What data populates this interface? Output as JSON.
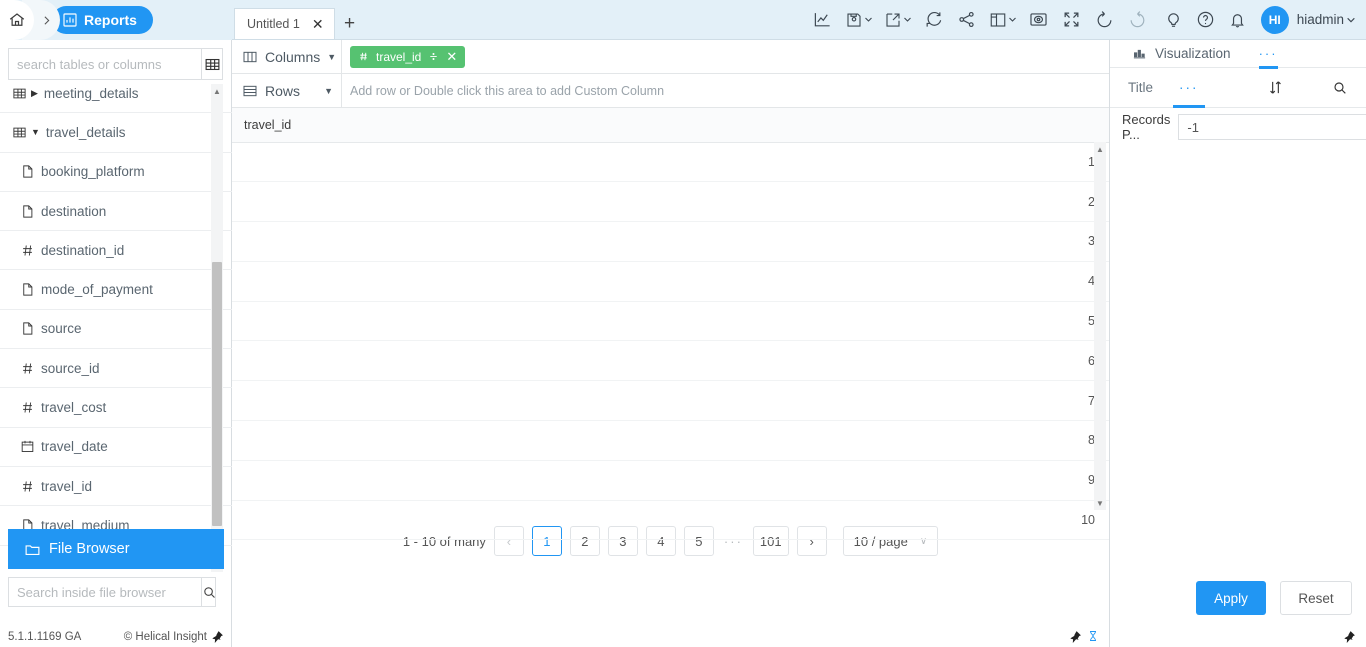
{
  "breadcrumb": {
    "home_icon": "home-icon",
    "separator": "chevron-right-icon",
    "active_label": "Reports",
    "active_icon": "bar-chart-icon"
  },
  "tabs": [
    {
      "label": "Untitled 1",
      "close": "✕",
      "active": true
    }
  ],
  "tab_add_label": "+",
  "toolbar_icons": [
    {
      "name": "line-chart-icon"
    },
    {
      "name": "save-icon",
      "caret": true
    },
    {
      "name": "export-icon",
      "caret": true
    },
    {
      "name": "refresh-icon"
    },
    {
      "name": "share-icon"
    },
    {
      "name": "layout-icon",
      "caret": true
    },
    {
      "name": "preview-icon"
    },
    {
      "name": "fullscreen-icon"
    },
    {
      "name": "undo-icon"
    },
    {
      "name": "redo-icon"
    }
  ],
  "header_right": {
    "bulb_icon": "lightbulb-icon",
    "help_icon": "help-icon",
    "bell_icon": "notification-bell-icon",
    "avatar_initials": "HI",
    "username": "hiadmin"
  },
  "sidebar": {
    "search_placeholder": "search tables or columns",
    "search_value": "",
    "grid_button_icon": "table-grid-icon",
    "tree": [
      {
        "label": "meeting_details",
        "type": "table",
        "expanded": false,
        "icon": "table-icon"
      },
      {
        "label": "travel_details",
        "type": "table",
        "expanded": true,
        "icon": "table-icon"
      },
      {
        "label": "booking_platform",
        "type": "string",
        "icon": "document-icon"
      },
      {
        "label": "destination",
        "type": "string",
        "icon": "document-icon"
      },
      {
        "label": "destination_id",
        "type": "number",
        "icon": "hash-icon"
      },
      {
        "label": "mode_of_payment",
        "type": "string",
        "icon": "document-icon"
      },
      {
        "label": "source",
        "type": "string",
        "icon": "document-icon"
      },
      {
        "label": "source_id",
        "type": "number",
        "icon": "hash-icon"
      },
      {
        "label": "travel_cost",
        "type": "number",
        "icon": "hash-icon"
      },
      {
        "label": "travel_date",
        "type": "date",
        "icon": "calendar-icon"
      },
      {
        "label": "travel_id",
        "type": "number",
        "icon": "hash-icon"
      },
      {
        "label": "travel_medium",
        "type": "string",
        "icon": "document-icon"
      }
    ],
    "file_browser": {
      "label": "File Browser",
      "icon": "folder-icon",
      "search_placeholder": "Search inside file browser",
      "search_value": "",
      "search_icon": "search-icon"
    },
    "footer": {
      "version": "5.1.1.1169 GA",
      "copyright": "© Helical Insight",
      "pin_icon": "pin-icon"
    }
  },
  "shelves": {
    "columns": {
      "label": "Columns",
      "icon": "columns-icon",
      "caret": "▼",
      "chips": [
        {
          "label": "travel_id",
          "type_icon": "hash-icon",
          "agg_icon": "divide-icon",
          "close": "✕"
        }
      ]
    },
    "rows": {
      "label": "Rows",
      "icon": "rows-icon",
      "caret": "▼",
      "placeholder": "Add row or Double click this area to add Custom Column",
      "chips": []
    }
  },
  "chart_data": {
    "type": "table",
    "title": "",
    "columns": [
      "travel_id"
    ],
    "rows": [
      [
        "1"
      ],
      [
        "2"
      ],
      [
        "3"
      ],
      [
        "4"
      ],
      [
        "5"
      ],
      [
        "6"
      ],
      [
        "7"
      ],
      [
        "8"
      ],
      [
        "9"
      ],
      [
        "10"
      ]
    ]
  },
  "pagination": {
    "summary": "1 - 10 of many",
    "prev": "‹",
    "next": "›",
    "pages": [
      "1",
      "2",
      "3",
      "4",
      "5"
    ],
    "ellipsis": "···",
    "last_page": "101",
    "active_page": "1",
    "page_size_label": "10 / page",
    "page_size_caret": "∨"
  },
  "main_footer": {
    "pin_icon": "pin-icon",
    "hourglass_icon": "hourglass-icon"
  },
  "right_panel": {
    "tabs": [
      {
        "label": "Visualization",
        "icon": "chart-panel-icon",
        "active": false
      },
      {
        "label": "···",
        "icon": "more-icon",
        "active": true
      }
    ],
    "sub_tabs": [
      {
        "label": "Title",
        "active": false
      },
      {
        "label": "···",
        "active": true
      }
    ],
    "sort_icon": "sort-icon",
    "search_icon": "search-icon",
    "fields": [
      {
        "label": "Records P...",
        "value": "-1",
        "name": "records-per-page-input"
      }
    ],
    "apply_label": "Apply",
    "reset_label": "Reset",
    "pin_icon": "pin-icon"
  },
  "colors": {
    "accent": "#2196f3",
    "chip_green": "#56c271",
    "header_bg": "#e3f0f8"
  }
}
